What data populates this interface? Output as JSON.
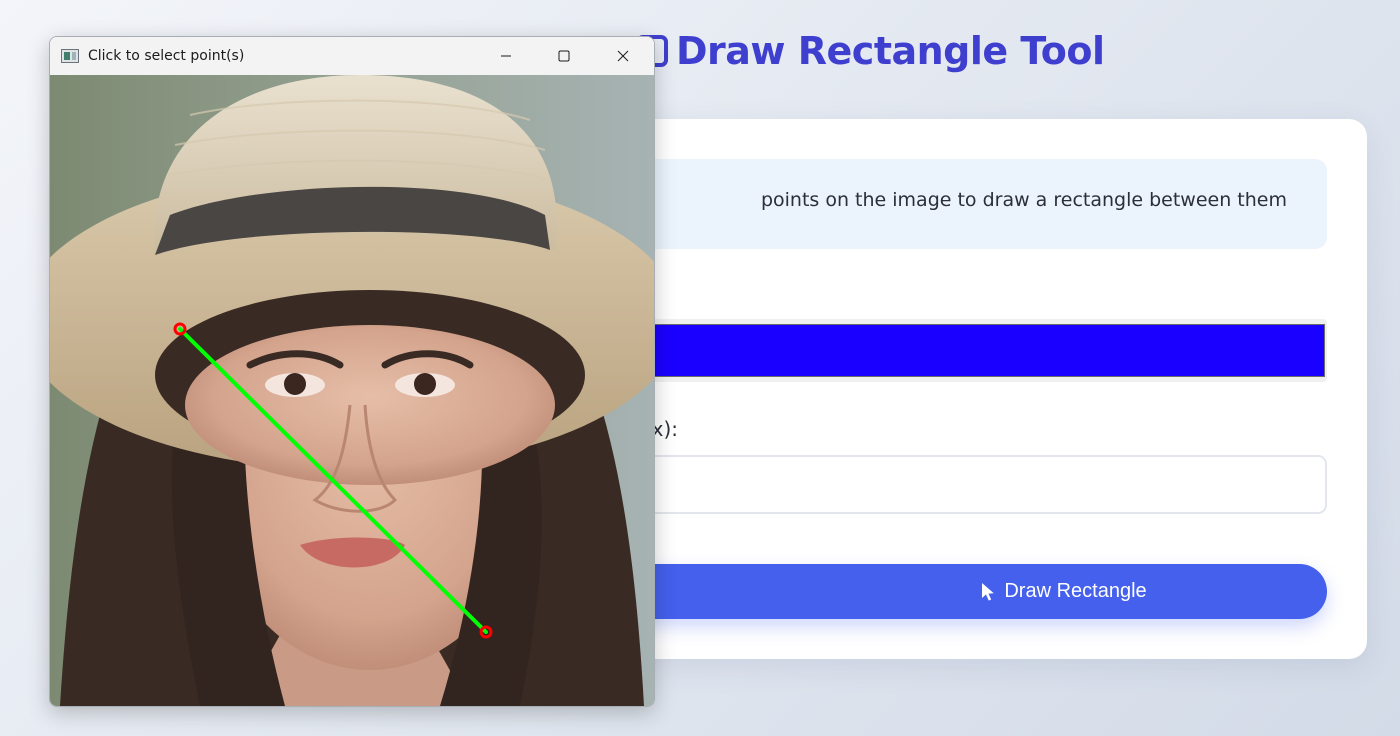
{
  "page": {
    "title": "Draw Rectangle Tool",
    "title_color": "#3f3fcf"
  },
  "icons": {
    "title": "rectangle-outline-icon",
    "button": "mouse-pointer-icon",
    "app": "image-window-icon",
    "minimize": "minimize-icon",
    "maximize": "maximize-icon",
    "close": "close-icon"
  },
  "card": {
    "instructions": "points on the image to draw a rectangle between them",
    "color_value": "#1a00ff",
    "thickness_label": "x):",
    "thickness_value": "",
    "draw_button_label": "Draw Rectangle",
    "button_color": "#4460ec"
  },
  "image_window": {
    "title": "Click to select point(s)",
    "line_color": "#00ff00",
    "point_color": "#ff0000"
  }
}
